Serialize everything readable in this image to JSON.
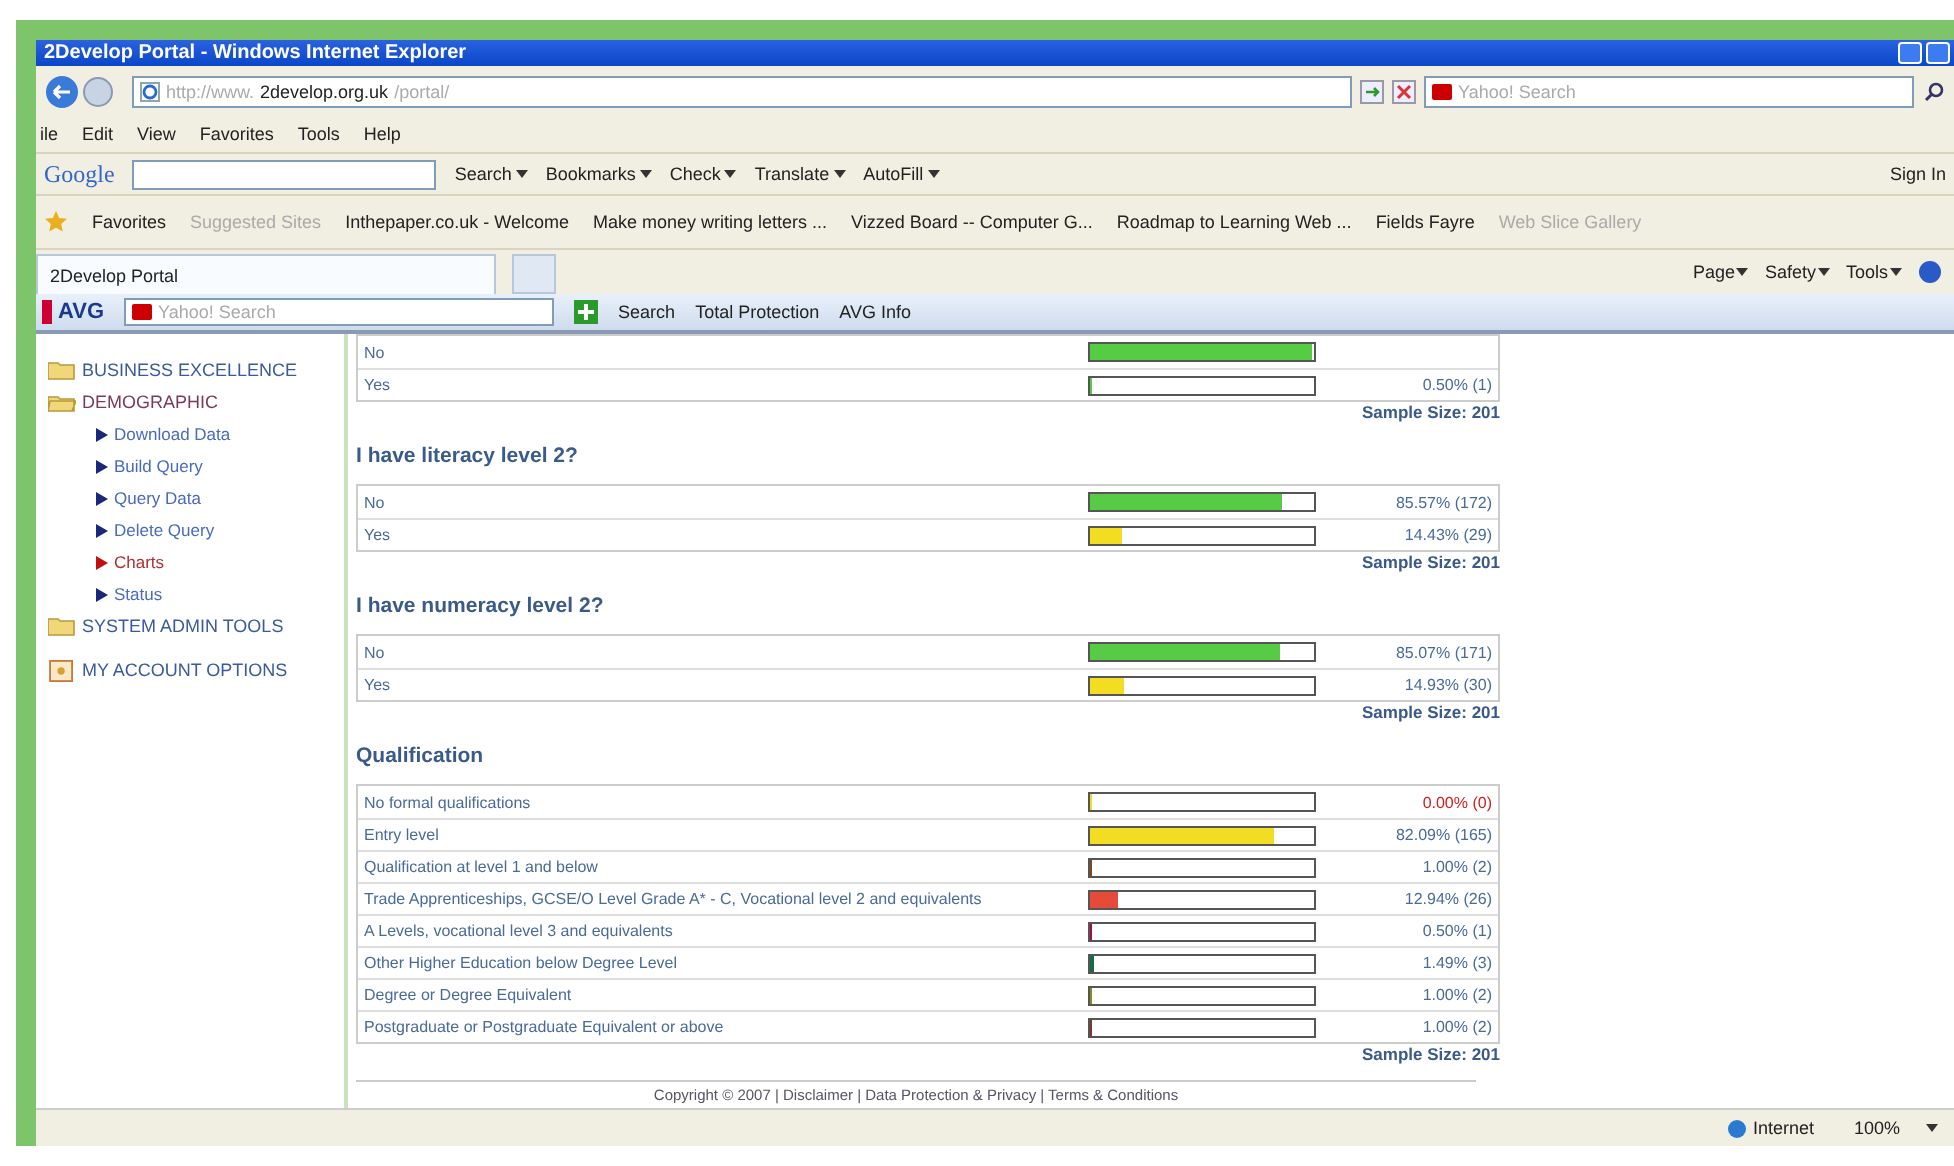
{
  "window": {
    "title": "2Develop Portal - Windows Internet Explorer"
  },
  "address": {
    "url_prefix": "http://www.",
    "url_host": "2develop.org.uk",
    "url_path": "/portal/",
    "search_placeholder": "Yahoo! Search"
  },
  "menu": [
    "ile",
    "Edit",
    "View",
    "Favorites",
    "Tools",
    "Help"
  ],
  "google_toolbar": {
    "logo": "Google",
    "items": [
      {
        "label": "Search",
        "dropdown": true
      },
      {
        "label": "Bookmarks",
        "dropdown": true
      },
      {
        "label": "Check",
        "dropdown": true
      },
      {
        "label": "Translate",
        "dropdown": true
      },
      {
        "label": "AutoFill",
        "dropdown": true
      }
    ],
    "sign_in": "Sign In"
  },
  "favorites_bar": {
    "label": "Favorites",
    "links": [
      {
        "label": "Suggested Sites",
        "disabled": true
      },
      {
        "label": "Inthepaper.co.uk - Welcome",
        "disabled": false
      },
      {
        "label": "Make money writing letters ...",
        "disabled": false
      },
      {
        "label": "Vizzed Board -- Computer G...",
        "disabled": false
      },
      {
        "label": "Roadmap to Learning Web ...",
        "disabled": false
      },
      {
        "label": "Fields Fayre",
        "disabled": false
      },
      {
        "label": "Web Slice Gallery",
        "disabled": true
      }
    ]
  },
  "tab": {
    "title": "2Develop Portal"
  },
  "command_bar": [
    "Page",
    "Safety",
    "Tools"
  ],
  "avg_toolbar": {
    "logo": "AVG",
    "search_placeholder": "Yahoo! Search",
    "search_button": "Search",
    "items": [
      "Total Protection",
      "AVG Info"
    ]
  },
  "sidebar": {
    "items": [
      {
        "label": "BUSINESS EXCELLENCE",
        "kind": "folder",
        "expanded": false
      },
      {
        "label": "DEMOGRAPHIC",
        "kind": "folder",
        "expanded": true,
        "children": [
          {
            "label": "Download Data",
            "selected": false
          },
          {
            "label": "Build Query",
            "selected": false
          },
          {
            "label": "Query Data",
            "selected": false
          },
          {
            "label": "Delete Query",
            "selected": false
          },
          {
            "label": "Charts",
            "selected": true
          },
          {
            "label": "Status",
            "selected": false
          }
        ]
      },
      {
        "label": "SYSTEM ADMIN TOOLS",
        "kind": "folder",
        "expanded": false
      },
      {
        "label": "MY ACCOUNT OPTIONS",
        "kind": "account"
      }
    ]
  },
  "results": [
    {
      "rows": [
        {
          "label": "No",
          "level": 0.995,
          "color": "#55cc44"
        },
        {
          "label": "Yes",
          "level": 0.005,
          "color": "#55cc44",
          "reading": "0.50% (1)"
        }
      ],
      "sample_size": "Sample Size: 201"
    },
    {
      "heading": "I have literacy level 2?",
      "rows": [
        {
          "label": "No",
          "level": 0.8557,
          "color": "#55cc44",
          "reading": "85.57% (172)"
        },
        {
          "label": "Yes",
          "level": 0.1443,
          "color": "#f2dd22",
          "reading": "14.43% (29)"
        }
      ],
      "sample_size": "Sample Size: 201"
    },
    {
      "heading": "I have numeracy level 2?",
      "rows": [
        {
          "label": "No",
          "level": 0.8507,
          "color": "#55cc44",
          "reading": "85.07% (171)"
        },
        {
          "label": "Yes",
          "level": 0.1493,
          "color": "#f2dd22",
          "reading": "14.93% (30)"
        }
      ],
      "sample_size": "Sample Size: 201"
    },
    {
      "heading": "Qualification",
      "rows": [
        {
          "label": "No formal qualifications",
          "level": 0,
          "color": "#f2dd22",
          "reading": "0.00% (0)"
        },
        {
          "label": "Entry level",
          "level": 0.8209,
          "color": "#f2dd22",
          "reading": "82.09% (165)"
        },
        {
          "label": "Qualification at level 1 and below",
          "level": 0.01,
          "color": "#7a4a2a",
          "reading": "1.00% (2)"
        },
        {
          "label": "Trade Apprenticeships, GCSE/O Level Grade A* - C, Vocational level 2 and equivalents",
          "level": 0.1294,
          "color": "#e84a3a",
          "reading": "12.94% (26)"
        },
        {
          "label": "A Levels, vocational level 3 and equivalents",
          "level": 0.005,
          "color": "#a01040",
          "reading": "0.50% (1)"
        },
        {
          "label": "Other Higher Education below Degree Level",
          "level": 0.0149,
          "color": "#1a6a4a",
          "reading": "1.49% (3)"
        },
        {
          "label": "Degree or Degree Equivalent",
          "level": 0.01,
          "color": "#8a8a20",
          "reading": "1.00% (2)"
        },
        {
          "label": "Postgraduate or Postgraduate Equivalent or above",
          "level": 0.01,
          "color": "#7a3a2a",
          "reading": "1.00% (2)"
        }
      ],
      "sample_size": "Sample Size: 201"
    }
  ],
  "footer": "Copyright © 2007 | Disclaimer | Data Protection & Privacy | Terms & Conditions",
  "status_bar": {
    "zone": "Internet",
    "zoom": "100%"
  }
}
